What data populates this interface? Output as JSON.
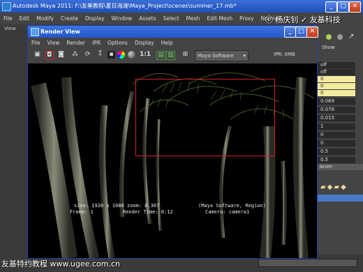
{
  "app": {
    "title": "Autodesk Maya 2011: F:\\友基教程\\夏日海滩\\Maya_Project\\scenes\\summer_17.mb*",
    "menus": [
      "File",
      "Edit",
      "Modify",
      "Create",
      "Display",
      "Window",
      "Assets",
      "Select",
      "Mesh",
      "Edit Mesh",
      "Proxy",
      "Normals"
    ],
    "left_strip_label": "View",
    "channel_values": [
      "off",
      "off",
      "0",
      "0",
      "0",
      "0.069",
      "0.076",
      "0.015",
      "1",
      "0",
      "0",
      "0.5",
      "0.5"
    ],
    "right_labels": {
      "show": "Show",
      "anim": "Anim"
    }
  },
  "render_view": {
    "title": "Render View",
    "menus": [
      "File",
      "View",
      "Render",
      "IPR",
      "Options",
      "Display",
      "Help"
    ],
    "renderer": "Maya Software",
    "ratio_label": "1:1",
    "ipr_label": "IPR: 0MB",
    "info": {
      "size": "size: 1920 x 1080 zoom: 0.307",
      "engine": "(Maya Software, Region)",
      "frame": "Frame: 1",
      "render_time": "Render Time: 0:12",
      "camera": "Camera: camera1"
    }
  },
  "watermarks": {
    "top": "ⓒ 杨庆钊 ✓ 友基科技",
    "bottom": "友基特约教程 www.ugee.com.cn"
  },
  "icons": [
    "film-clapper-icon",
    "region-render-icon",
    "snapshot-icon",
    "refresh-icon",
    "color-wheel-icon",
    "sphere-icon",
    "keep-image-icon",
    "remove-image-icon",
    "ipr-icon",
    "minimize-icon",
    "maximize-icon",
    "close-icon"
  ]
}
